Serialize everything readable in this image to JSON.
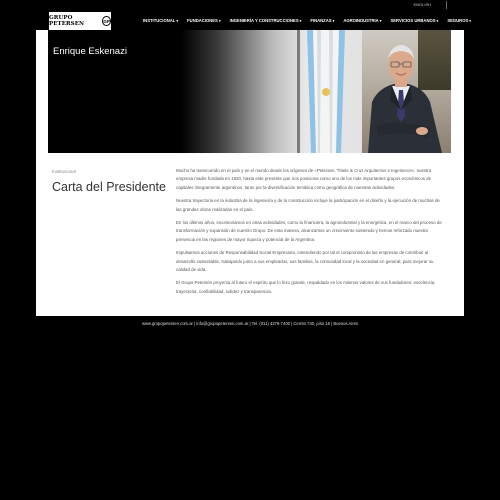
{
  "header": {
    "language_link": "ENGLISH",
    "logo": {
      "text": "GRUPO PETERSEN",
      "monogram": "GP"
    },
    "nav": [
      {
        "label": "INSTITUCIONAL"
      },
      {
        "label": "FUNDACIONES"
      },
      {
        "label": "INGENIERÍA Y CONSTRUCCIONES"
      },
      {
        "label": "FINANZAS"
      },
      {
        "label": "AGROINDUSTRIA"
      },
      {
        "label": "SERVICIOS URBANOS"
      },
      {
        "label": "SEGUROS"
      }
    ]
  },
  "hero": {
    "name": "Enrique Eskenazi"
  },
  "section": {
    "breadcrumb": "Institucional",
    "title": "Carta del Presidente"
  },
  "body": {
    "paragraphs": [
      "Mucho ha transcurrido en el país y en el mundo desde los orígenes de «Petersen, Thiele & Cruz Arquitectos e Ingenieros», nuestra empresa madre fundada en 1920, hasta este presente que nos posiciona como uno de los más importantes grupos económicos de capitales íntegramente argentinos, tanto por la diversificación temática como geográfica de nuestras actividades.",
      "Nuestra trayectoria en la industria de la ingeniería y de la construcción incluye la participación en el diseño y la ejecución de muchas de las grandes obras realizadas en el país.",
      "En los últimos años, incursionamos en otras actividades, como la financiera, la agroindustrial y la energética, en el marco del proceso de transformación y expansión de nuestro Grupo. De esta manera, alcanzamos un crecimiento sostenido y hemos reforzado nuestra presencia en las regiones de mayor riqueza y potencial de la Argentina.",
      "Impulsamos acciones de Responsabilidad Social Empresaria, entendiendo por tal el compromiso de las empresas de contribuir al desarrollo sustentable, trabajando junto a sus empleados, sus familias, la comunidad local y la sociedad en general, para mejorar su calidad de vida.",
      "El Grupo Petersen proyecta al futuro el espíritu que lo hizo grande, respaldado en los mismos valores de sus fundadores: excelencia, trayectoria, confiabilidad, solidez y transparencia."
    ]
  },
  "footer": {
    "text": "www.grupopetersen.com.ar | info@grupopetersen.com.ar | Tel. (011) 4378-7400 | Cerrito 740, piso 18 | Buenos Aires"
  }
}
